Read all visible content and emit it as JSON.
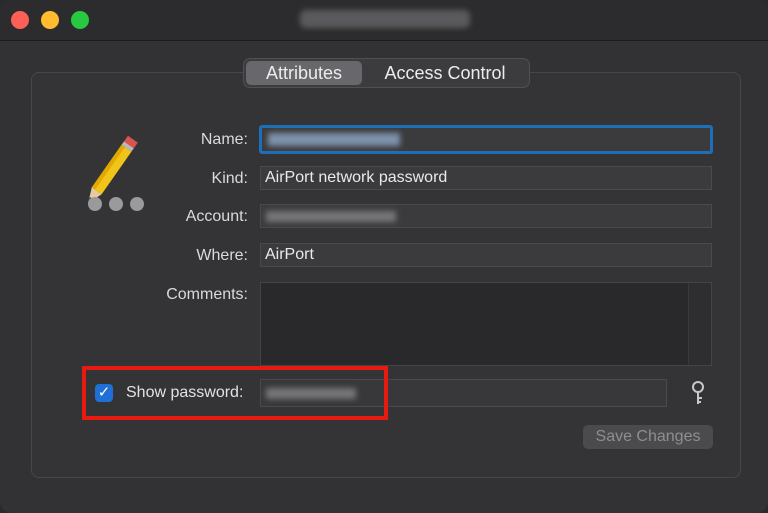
{
  "window": {
    "title": "TP-LINK_XXXXXX"
  },
  "tabs": [
    {
      "label": "Attributes",
      "selected": true
    },
    {
      "label": "Access Control",
      "selected": false
    }
  ],
  "form": {
    "name_label": "Name:",
    "name_value": "TP-LINK_XXXXXX",
    "kind_label": "Kind:",
    "kind_value": "AirPort network password",
    "account_label": "Account:",
    "account_value": "TP-LINK_XXXXXX",
    "where_label": "Where:",
    "where_value": "AirPort",
    "comments_label": "Comments:",
    "comments_value": "",
    "show_password_label": "Show password:",
    "show_password_checked": true,
    "password_value": "XXXXXXXX"
  },
  "buttons": {
    "save_changes": "Save Changes"
  },
  "icons": {
    "app_icon": "pencil-password-icon",
    "key": "key-icon"
  },
  "colors": {
    "accent": "#1f6fd6",
    "highlight_box": "#e81a10"
  }
}
